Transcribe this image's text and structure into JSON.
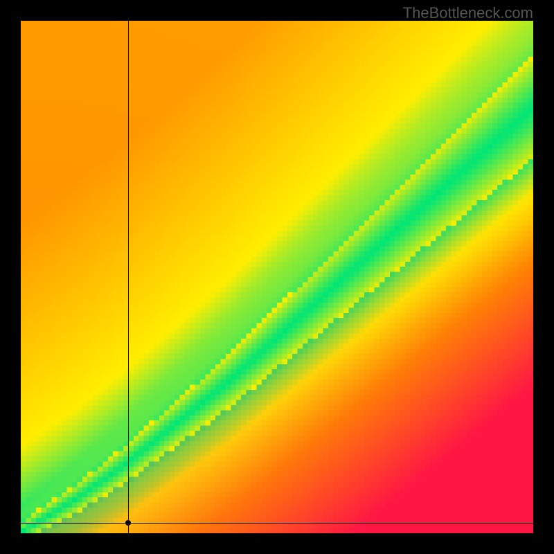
{
  "watermark": "TheBottleneck.com",
  "chart_data": {
    "type": "heatmap",
    "title": "",
    "xlabel": "",
    "ylabel": "",
    "xlim": [
      0,
      100
    ],
    "ylim": [
      0,
      100
    ],
    "grid": false,
    "legend": false,
    "colormap_description": "Diverging red→orange→yellow→green where green marks the optimal diagonal balance band; green band widens toward upper-right.",
    "colors": {
      "low": "#ff1744",
      "mid_low": "#ff8a00",
      "mid": "#ffee00",
      "high": "#00e676"
    },
    "optimal_band": {
      "description": "Ideal pairing ridge (green) roughly follows y ≈ 0.78·x with slight upward curvature; half-width grows from ~2 units near origin to ~10 units near (100,100).",
      "ridge_points_xy": [
        [
          0,
          0
        ],
        [
          10,
          6
        ],
        [
          20,
          13
        ],
        [
          30,
          21
        ],
        [
          40,
          29
        ],
        [
          50,
          38
        ],
        [
          60,
          47
        ],
        [
          70,
          56
        ],
        [
          80,
          65
        ],
        [
          90,
          74
        ],
        [
          100,
          83
        ]
      ]
    },
    "crosshair": {
      "x": 21,
      "y": 2,
      "note": "User's selected CPU/GPU point; lies far below green band ⇒ severe bottleneck."
    },
    "resolution_cells": 100
  }
}
